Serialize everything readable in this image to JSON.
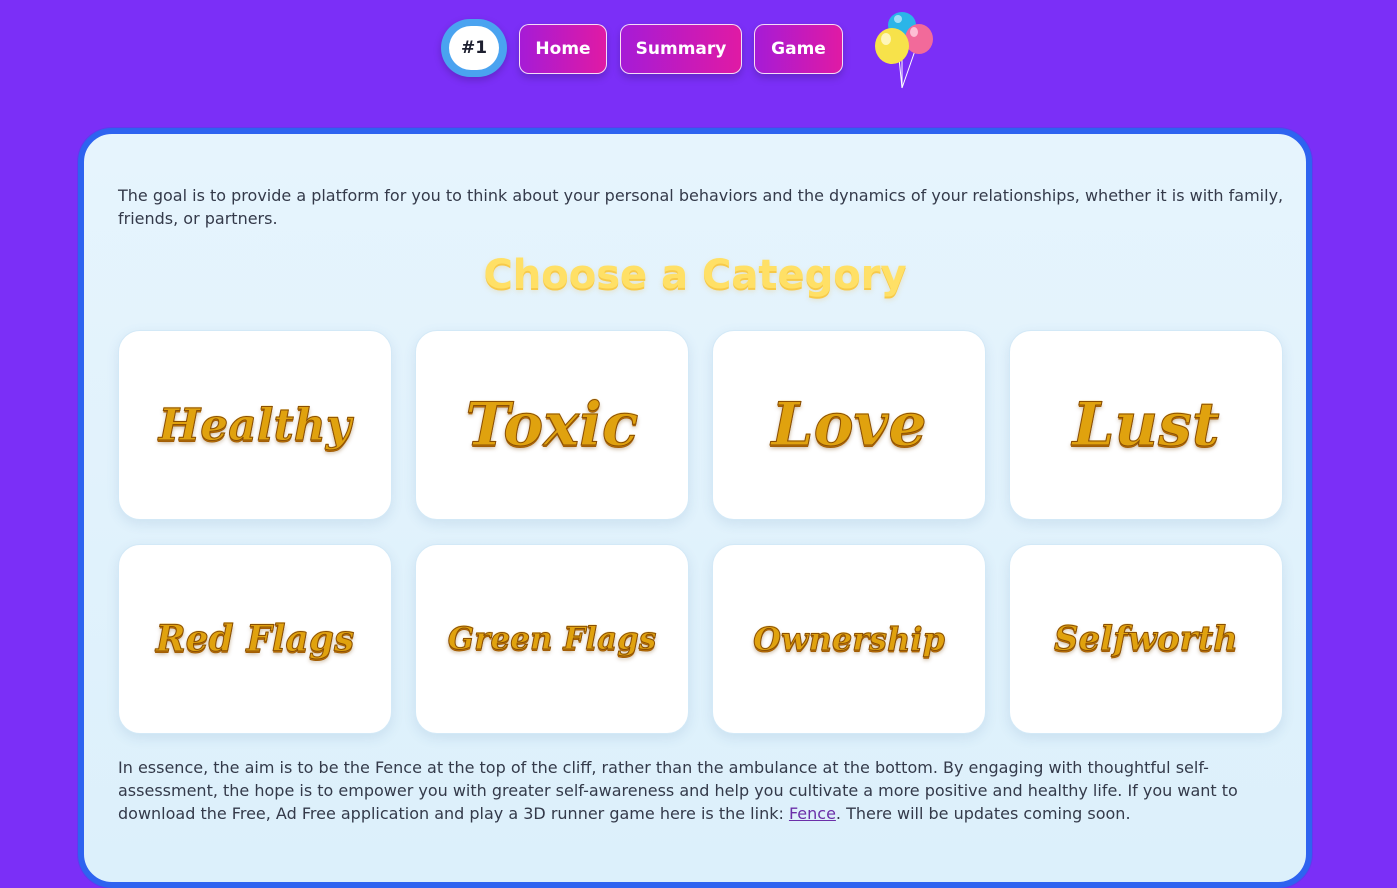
{
  "nav": {
    "logo_label": "#1",
    "home_label": "Home",
    "summary_label": "Summary",
    "game_label": "Game",
    "balloons_icon": "balloons-icon"
  },
  "content": {
    "intro_text": "The goal is to provide a platform for you to think about your personal behaviors and the dynamics of your relationships, whether it is with family, friends, or partners.",
    "heading": "Choose a Category",
    "categories": [
      {
        "label": "Healthy"
      },
      {
        "label": "Toxic"
      },
      {
        "label": "Love"
      },
      {
        "label": "Lust"
      },
      {
        "label": "Red Flags"
      },
      {
        "label": "Green Flags"
      },
      {
        "label": "Ownership"
      },
      {
        "label": "Selfworth"
      }
    ],
    "outro_before": "In essence, the aim is to be the Fence at the top of the cliff, rather than the ambulance at the bottom. By engaging with thoughtful self-assessment, the hope is to empower you with greater self-awareness and help you cultivate a more positive and healthy life. If you want to download the Free, Ad Free application and play a 3D runner game here is the link: ",
    "outro_link": "Fence",
    "outro_after": ". There will be updates coming soon."
  },
  "colors": {
    "background": "#7b2ff7",
    "card_border": "#2e63f0",
    "heading": "#ffe066",
    "category_gold": "#e0a20e",
    "nav_gradient_start": "#a61bd6",
    "nav_gradient_end": "#e01aa4"
  }
}
